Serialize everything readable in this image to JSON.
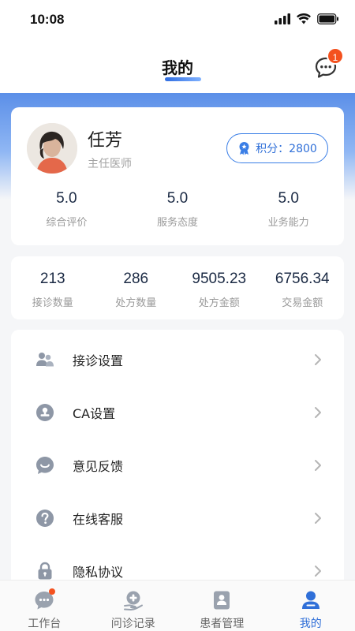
{
  "status_bar": {
    "time": "10:08",
    "icons": [
      "signal-icon",
      "wifi-icon",
      "battery-icon"
    ]
  },
  "nav": {
    "title": "我的",
    "message_badge": "1",
    "message_icon": "chat-bubble-icon"
  },
  "profile": {
    "name": "任芳",
    "title": "主任医师",
    "points_label": "积分：2800",
    "ratings": [
      {
        "value": "5.0",
        "label": "综合评价"
      },
      {
        "value": "5.0",
        "label": "服务态度"
      },
      {
        "value": "5.0",
        "label": "业务能力"
      }
    ]
  },
  "counts": [
    {
      "value": "213",
      "label": "接诊数量"
    },
    {
      "value": "286",
      "label": "处方数量"
    },
    {
      "value": "9505.23",
      "label": "处方金额"
    },
    {
      "value": "6756.34",
      "label": "交易金额"
    }
  ],
  "menu": [
    {
      "label": "接诊设置",
      "icon": "users-icon"
    },
    {
      "label": "CA设置",
      "icon": "stamp-icon"
    },
    {
      "label": "意见反馈",
      "icon": "smile-bubble-icon"
    },
    {
      "label": "在线客服",
      "icon": "help-icon"
    },
    {
      "label": "隐私协议",
      "icon": "lock-icon"
    }
  ],
  "tabs": [
    {
      "label": "工作台",
      "icon": "workbench-icon",
      "active": false,
      "dot": true
    },
    {
      "label": "问诊记录",
      "icon": "consult-record-icon",
      "active": false
    },
    {
      "label": "患者管理",
      "icon": "patient-icon",
      "active": false
    },
    {
      "label": "我的",
      "icon": "profile-icon",
      "active": true
    }
  ],
  "colors": {
    "accent": "#2f6fd8",
    "badge": "#f4511e",
    "icon_gray": "#8e97a6"
  }
}
